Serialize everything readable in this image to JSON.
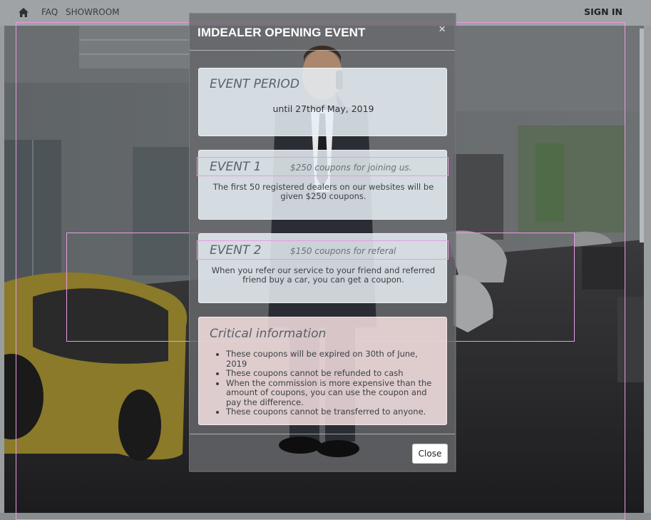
{
  "nav": {
    "home_icon": "home-icon",
    "faq": "FAQ",
    "showroom": "SHOWROOM",
    "sign_in": "SIGN IN"
  },
  "modal": {
    "title": "IMDEALER OPENING EVENT",
    "close_x": "×",
    "period": {
      "heading": "EVENT PERIOD",
      "text": "until 27thof May, 2019"
    },
    "event1": {
      "heading": "EVENT 1",
      "subtitle": "$250 coupons for joining us.",
      "text": "The first 50 registered dealers on our websites will be given $250 coupons."
    },
    "event2": {
      "heading": "EVENT 2",
      "subtitle": "$150 coupons for referal",
      "text": "When you refer our service to your friend and referred friend buy a car, you can get a coupon."
    },
    "critical": {
      "heading": "Critical information",
      "items": [
        "These coupons will be expired on 30th of June, 2019",
        "These coupons cannot be refunded to cash",
        "When the commission is more expensive than the amount of coupons, you can use the coupon and pay the difference.",
        "These coupons cannot be transferred to anyone."
      ]
    },
    "close_button": "Close"
  },
  "colors": {
    "overlay": "#5f5f62",
    "info_card": "#e8f0f6",
    "critical_card": "#f6e0e2",
    "guide_outline": "#e89be2"
  }
}
